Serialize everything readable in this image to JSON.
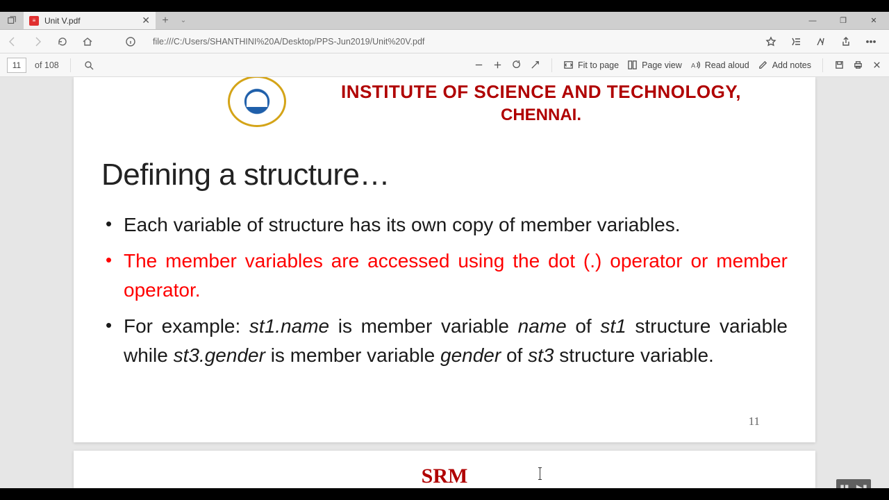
{
  "tab": {
    "title": "Unit V.pdf"
  },
  "address": {
    "url": "file:///C:/Users/SHANTHINI%20A/Desktop/PPS-Jun2019/Unit%20V.pdf"
  },
  "pdfbar": {
    "page_current": "11",
    "page_total": "of 108",
    "fit": "Fit to page",
    "pageview": "Page view",
    "readaloud": "Read aloud",
    "addnotes": "Add notes"
  },
  "doc": {
    "inst_l1": "INSTITUTE OF SCIENCE AND TECHNOLOGY,",
    "inst_l2": "CHENNAI.",
    "heading": "Defining a structure…",
    "b1": "Each variable of structure has its own copy of  member variables.",
    "b2": "The member variables are accessed using the  dot (.) operator or member operator.",
    "b3_a": "For example: ",
    "b3_it1": "st1.name",
    "b3_b": " is member variable  ",
    "b3_it2": "name",
    "b3_c": " of ",
    "b3_it3": "st1",
    "b3_d": " structure variable while  ",
    "b3_it4": "st3.gender",
    "b3_e": " is member variable ",
    "b3_it5": "gender",
    "b3_f": " of ",
    "b3_it6": "st3",
    "b3_g": "  structure variable.",
    "pgnum": "11",
    "next_srm": "SRM"
  }
}
